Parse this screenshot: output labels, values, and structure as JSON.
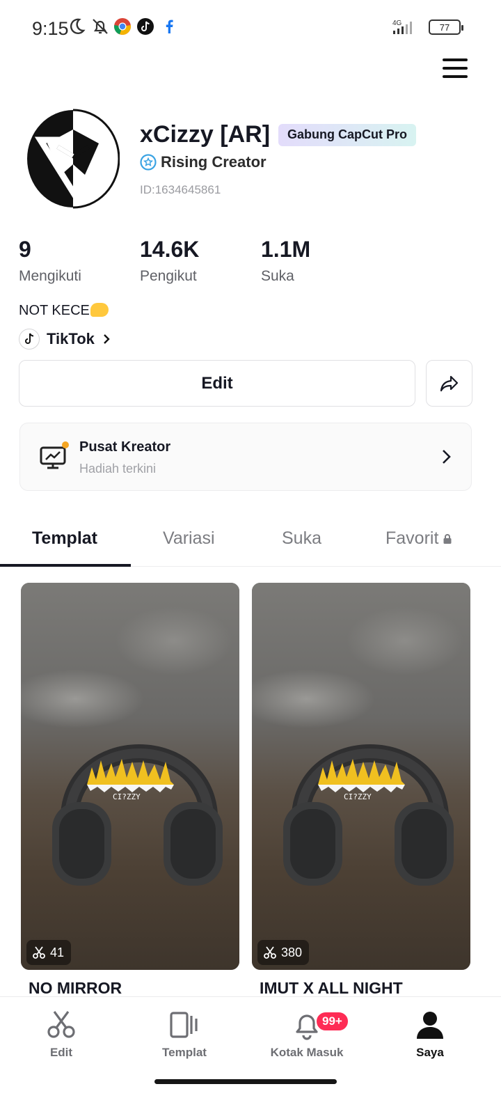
{
  "status_bar": {
    "time": "9:15",
    "network": "4G",
    "battery": "77",
    "icons": [
      "moon-icon",
      "bell-off-icon",
      "chrome-icon",
      "tiktok-icon",
      "facebook-icon",
      "signal-icon",
      "battery-icon"
    ]
  },
  "header": {
    "menu_icon": "hamburger-menu-icon"
  },
  "profile": {
    "name": "xCizzy [AR]",
    "pro_badge": "Gabung CapCut Pro",
    "creator_level": "Rising Creator",
    "user_id": "ID:1634645861",
    "stats": [
      {
        "value": "9",
        "label": "Mengikuti"
      },
      {
        "value": "14.6K",
        "label": "Pengikut"
      },
      {
        "value": "1.1M",
        "label": "Suka"
      }
    ],
    "bio": "NOT KECE",
    "linked_account": "TikTok"
  },
  "actions": {
    "edit_label": "Edit",
    "share_icon": "share-icon"
  },
  "creator_center": {
    "title": "Pusat Kreator",
    "subtitle": "Hadiah terkini"
  },
  "tabs": [
    {
      "label": "Templat",
      "active": true
    },
    {
      "label": "Variasi",
      "active": false
    },
    {
      "label": "Suka",
      "active": false
    },
    {
      "label": "Favorit",
      "active": false,
      "locked": true
    }
  ],
  "templates": [
    {
      "title": "NO MIRROR",
      "uses": "41"
    },
    {
      "title": "IMUT X ALL NIGHT",
      "uses": "380"
    }
  ],
  "bottom_nav": {
    "items": [
      {
        "label": "Edit",
        "icon": "scissors-icon"
      },
      {
        "label": "Templat",
        "icon": "template-icon"
      },
      {
        "label": "Kotak Masuk",
        "icon": "bell-icon",
        "badge": "99+"
      },
      {
        "label": "Saya",
        "icon": "person-icon",
        "active": true
      }
    ]
  },
  "colors": {
    "text_primary": "#161823",
    "text_secondary": "#7b7c81",
    "badge_red": "#fe2c55",
    "creator_dot": "#f5a623",
    "verified_blue": "#3aa3e3"
  }
}
